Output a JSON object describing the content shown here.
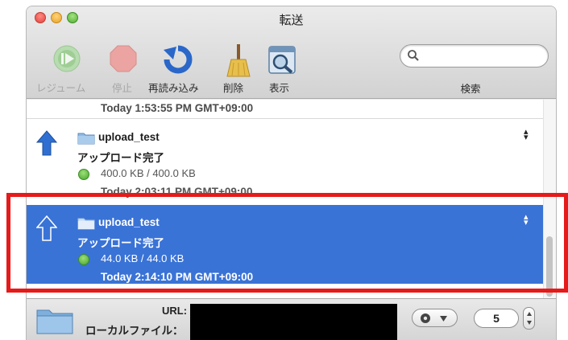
{
  "window": {
    "title": "転送"
  },
  "toolbar": {
    "items": [
      {
        "label": "レジューム",
        "icon": "resume-icon",
        "enabled": false
      },
      {
        "label": "停止",
        "icon": "stop-icon",
        "enabled": false
      },
      {
        "label": "再読み込み",
        "icon": "reload-icon",
        "enabled": true
      },
      {
        "label": "削除",
        "icon": "broom-icon",
        "enabled": true
      },
      {
        "label": "表示",
        "icon": "show-icon",
        "enabled": true
      }
    ],
    "search": {
      "placeholder": "",
      "label": "検索"
    }
  },
  "transfers": {
    "previous_time": "Today 1:53:55 PM GMT+09:00",
    "items": [
      {
        "name": "upload_test",
        "status": "アップロード完了",
        "size": "400.0 KB / 400.0 KB",
        "time": "Today 2:03:11 PM GMT+09:00",
        "selected": false,
        "direction": "upload"
      },
      {
        "name": "upload_test",
        "status": "アップロード完了",
        "size": "44.0 KB / 44.0 KB",
        "time": "Today 2:14:10 PM GMT+09:00",
        "selected": true,
        "direction": "upload"
      }
    ]
  },
  "footer": {
    "url_label": "URL:",
    "local_file_label": "ローカルファイル：",
    "connections_value": "5"
  },
  "colors": {
    "selection": "#3a73d6",
    "highlight_box": "#e61a1a",
    "status_dot": "#45a52a"
  }
}
